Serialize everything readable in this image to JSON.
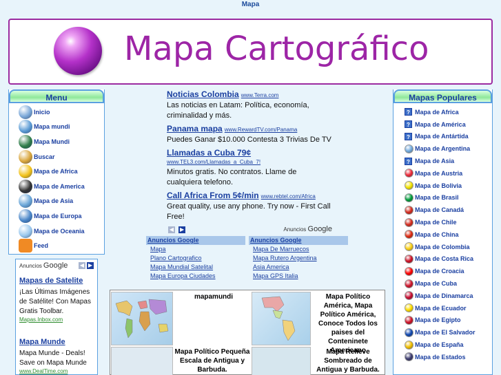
{
  "top": {
    "title": "Mapa"
  },
  "banner": {
    "title": "Mapa Cartográfico"
  },
  "menu": {
    "heading": "Menu",
    "items": [
      {
        "label": "Inicio",
        "icon": "house-icon",
        "color": "#7aa7d8"
      },
      {
        "label": "Mapa mundi",
        "icon": "globe-icon",
        "color": "#5b9bd5"
      },
      {
        "label": "Mapa Mundi",
        "icon": "globe-icon",
        "color": "#2f7d4a"
      },
      {
        "label": "Buscar",
        "icon": "magnifier-icon",
        "color": "#d9a53a"
      },
      {
        "label": "Mapa de Africa",
        "icon": "star-icon",
        "color": "#f2c21a"
      },
      {
        "label": "Mapa de America",
        "icon": "globe-icon",
        "color": "#333333"
      },
      {
        "label": "Mapa de Asia",
        "icon": "globe-icon",
        "color": "#6aa6d8"
      },
      {
        "label": "Mapa de Europa",
        "icon": "globe-icon",
        "color": "#4a86c8"
      },
      {
        "label": "Mapa de Oceania",
        "icon": "globe-icon",
        "color": "#9ac8ee"
      },
      {
        "label": "Feed",
        "icon": "rss-icon",
        "color": "#f08a24"
      }
    ]
  },
  "left_ads": {
    "by_label": "Anuncios",
    "google": "Google",
    "ads": [
      {
        "title": "Mapas de Satelite",
        "body": "¡Las Últimas Imágenes de Satélite! Con Mapas Gratis Toolbar.",
        "url": "Mapas.Inbox.com"
      },
      {
        "title": "Mapa Munde",
        "body": "Mapa Munde - Deals! Save on Mapa Munde",
        "url": "www.DealTime.com"
      }
    ]
  },
  "center_ads": {
    "ads": [
      {
        "title": "Noticias Colombia",
        "url": "www.Terra.com",
        "body": "Las noticias en Latam: Política, economía, criminalidad y más."
      },
      {
        "title": "Panama mapa",
        "url": "www.RewardTV.com/Panama",
        "body": "Puedes Ganar $10.000 Contesta 3 Trivias De TV"
      },
      {
        "title": "Llamadas a Cuba 79¢",
        "url": "www.TEL3.com/Llamadas_a_Cuba_7!",
        "body": "Minutos gratis. No contratos. Llame de cualquiera telefono."
      },
      {
        "title": "Call Africa From 5¢/min",
        "url": "www.rebtel.com/Africa",
        "body": "Great quality, use any phone. Try now - First Call Free!"
      }
    ],
    "by_label": "Anuncios",
    "google": "Google"
  },
  "link_units": [
    {
      "heading": "Anuncios Google",
      "links": [
        "Mapa",
        "Plano Cartografico",
        "Mapa Mundial Satelital",
        "Mapa Europa Ciudades"
      ]
    },
    {
      "heading": "Anuncios Google",
      "links": [
        "Mapa De Marruecos",
        "Mapa Rutero Argentina",
        "Asia America",
        "Mapa GPS Italia"
      ]
    }
  ],
  "maps": [
    {
      "caption": "mapamundi"
    },
    {
      "caption": "Mapa Político América, Mapa Político América, Conoce Todos los paises del Conteninete Americano"
    },
    {
      "caption": "Mapa Político Pequeña Escala de Antigua y Barbuda."
    },
    {
      "caption": "Mapa Relieve Sombreado de Antigua y Barbuda."
    }
  ],
  "popular": {
    "heading": "Mapas Populares",
    "items": [
      {
        "label": "Mapa de Africa",
        "kind": "qm"
      },
      {
        "label": "Mapa de América",
        "kind": "qm"
      },
      {
        "label": "Mapa de Antártida",
        "kind": "qm"
      },
      {
        "label": "Mapa de Argentina",
        "kind": "flag",
        "color": "#74acdf"
      },
      {
        "label": "Mapa de Asia",
        "kind": "qm"
      },
      {
        "label": "Mapa de Austria",
        "kind": "flag",
        "color": "#ed2939"
      },
      {
        "label": "Mapa de Bolivia",
        "kind": "flag",
        "color": "#f4e400"
      },
      {
        "label": "Mapa de Brasil",
        "kind": "flag",
        "color": "#009b3a"
      },
      {
        "label": "Mapa de Canadá",
        "kind": "flag",
        "color": "#d52b1e"
      },
      {
        "label": "Mapa de Chile",
        "kind": "flag",
        "color": "#d52b1e"
      },
      {
        "label": "Mapa de China",
        "kind": "flag",
        "color": "#de2910"
      },
      {
        "label": "Mapa de Colombia",
        "kind": "flag",
        "color": "#fcd116"
      },
      {
        "label": "Mapa de Costa Rica",
        "kind": "flag",
        "color": "#ce1126"
      },
      {
        "label": "Mapa de Croacia",
        "kind": "flag",
        "color": "#ff0000"
      },
      {
        "label": "Mapa de Cuba",
        "kind": "flag",
        "color": "#cf142b"
      },
      {
        "label": "Mapa de Dinamarca",
        "kind": "flag",
        "color": "#c60c30"
      },
      {
        "label": "Mapa de Ecuador",
        "kind": "flag",
        "color": "#ffdd00"
      },
      {
        "label": "Mapa de Egipto",
        "kind": "flag",
        "color": "#ce1126"
      },
      {
        "label": "Mapa de El Salvador",
        "kind": "flag",
        "color": "#0f47af"
      },
      {
        "label": "Mapa de España",
        "kind": "flag",
        "color": "#f1bf00"
      },
      {
        "label": "Mapa de Estados",
        "kind": "flag",
        "color": "#3c3b6e"
      }
    ]
  }
}
